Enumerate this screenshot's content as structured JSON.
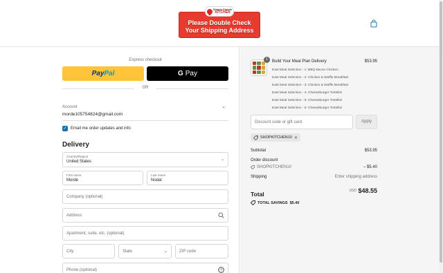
{
  "header": {
    "logo_top": "Simply Simple",
    "logo_main": "KITCHEN",
    "banner_line1": "Please Double Check",
    "banner_line2": "Your Shipping Address"
  },
  "express": {
    "label": "Express checkout",
    "paypal_a": "Pay",
    "paypal_b": "Pal",
    "gpay_g": "G",
    "gpay_text": "Pay",
    "or": "OR"
  },
  "account": {
    "label": "Account",
    "email": "morde105754824@gmail.com",
    "email_opt_in": "Email me order updates and info"
  },
  "delivery": {
    "title": "Delivery",
    "country_label": "Country/Region",
    "country_value": "United States",
    "first_label": "First name",
    "first_value": "Morde",
    "last_label": "Last name",
    "last_value": "Nodal",
    "company_ph": "Company (optional)",
    "address_ph": "Address",
    "apt_ph": "Apartment, suite, etc. (optional)",
    "city_ph": "City",
    "state_ph": "State",
    "zip_ph": "ZIP code",
    "phone_ph": "Phone (optional)"
  },
  "cart": {
    "qty": "1",
    "product_title": "Build Your Meal Plan Delivery",
    "product_price": "$53.95",
    "selections": [
      "East Meal Selection - 1: BBQ Bacon Chicken",
      "East Meal Selection - 2: Chicken & Waffle Breakfast",
      "East Meal Selection - 3: Chicken & Waffle Breakfast",
      "East Meal Selection - 4: Cheeseburger Tortellini",
      "East Meal Selection - 5: Cheeseburger Tortellini",
      "East Meal Selection - 6: Cheeseburger Tortellini"
    ]
  },
  "discount": {
    "placeholder": "Discount code or gift card",
    "apply_label": "Apply",
    "code": "SHOPKITCHEN10"
  },
  "summary": {
    "subtotal_label": "Subtotal",
    "subtotal_value": "$53.95",
    "order_discount_label": "Order discount",
    "discount_code": "SHOPKITCHEN10",
    "discount_value": "– $5.40",
    "shipping_label": "Shipping",
    "shipping_value": "Enter shipping address",
    "total_label": "Total",
    "currency": "USD",
    "total_value": "$48.55",
    "savings_label": "TOTAL SAVINGS",
    "savings_value": "$5.40"
  },
  "colors": {
    "banner_red": "#e63b2e",
    "paypal_yellow": "#ffc439",
    "accent_blue": "#1773b0",
    "summary_bg": "#f5f5f5"
  }
}
